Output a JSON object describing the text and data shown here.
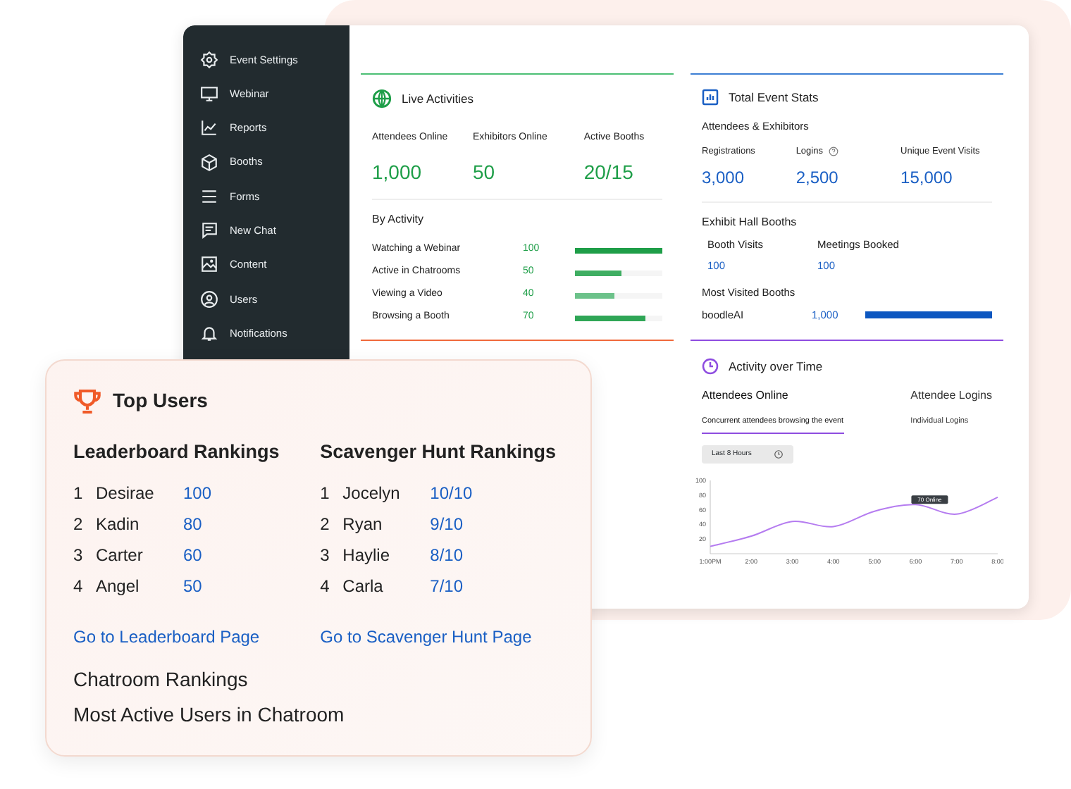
{
  "sidebar": {
    "items": [
      {
        "label": "Event Settings"
      },
      {
        "label": "Webinar"
      },
      {
        "label": "Reports"
      },
      {
        "label": "Booths"
      },
      {
        "label": "Forms"
      },
      {
        "label": "New Chat"
      },
      {
        "label": "Content"
      },
      {
        "label": "Users"
      },
      {
        "label": "Notifications"
      }
    ]
  },
  "live_activities": {
    "title": "Live Activities",
    "stats": [
      {
        "label": "Attendees Online",
        "value": "1,000"
      },
      {
        "label": "Exhibitors Online",
        "value": "50"
      },
      {
        "label": "Active Booths",
        "value": "20/15"
      }
    ],
    "by_activity": {
      "title": "By Activity",
      "rows": [
        {
          "label": "Watching a Webinar",
          "value": "100",
          "level": 1,
          "color": "#1e9e48"
        },
        {
          "label": "Active in Chatrooms",
          "value": "50",
          "level": 0.54,
          "color": "#3fae62"
        },
        {
          "label": "Viewing a Video",
          "value": "40",
          "level": 0.45,
          "color": "#6cc28a"
        },
        {
          "label": "Browsing a Booth",
          "value": "70",
          "level": 0.8,
          "color": "#2fa656"
        }
      ]
    }
  },
  "total_event_stats": {
    "title": "Total Event Stats",
    "subtitle": "Attendees & Exhibitors",
    "stats": [
      {
        "kind": "plain",
        "label": "Registrations",
        "value": "3,000"
      },
      {
        "kind": "help",
        "label": "Logins",
        "value": "2,500"
      },
      {
        "kind": "plain",
        "label": "Unique Event Visits",
        "value": "15,000"
      }
    ],
    "exhibit_hall": {
      "title": "Exhibit Hall Booths",
      "stats": [
        {
          "label": "Booth Visits",
          "value": "100"
        },
        {
          "label": "Meetings Booked",
          "value": "100"
        }
      ]
    },
    "most_visited": {
      "title": "Most Visited Booths",
      "rows": [
        {
          "label": "boodleAI",
          "value": "1,000",
          "level": 1
        }
      ]
    }
  },
  "activity_over_time": {
    "title": "Activity over Time",
    "tabs": [
      {
        "label": "Attendees Online",
        "description": "Concurrent attendees browsing the event",
        "selected": true
      },
      {
        "label": "Attendee Logins",
        "description": "Individual Logins",
        "selected": false
      }
    ],
    "range": "Last 8 Hours",
    "chart_data": {
      "type": "line",
      "categories": [
        "1:00PM",
        "2:00",
        "3:00",
        "4:00",
        "5:00",
        "6:00",
        "7:00",
        "8:00"
      ],
      "series": [
        {
          "color": "#b57cf0",
          "values": [
            10,
            24,
            44,
            37,
            58,
            67,
            54,
            77
          ]
        }
      ],
      "ylim": [
        0,
        100
      ],
      "yticks": [
        20,
        40,
        60,
        80,
        100
      ],
      "annotations": [
        {
          "x": "6:00",
          "y": 67,
          "text": "70 Online"
        }
      ]
    }
  },
  "top_users": {
    "title": "Top Users",
    "rankings": [
      {
        "title": "Leaderboard Rankings",
        "rows": [
          {
            "rank": "1",
            "name": "Desirae",
            "score": "100"
          },
          {
            "rank": "2",
            "name": "Kadin",
            "score": "80"
          },
          {
            "rank": "3",
            "name": "Carter",
            "score": "60"
          },
          {
            "rank": "4",
            "name": "Angel",
            "score": "50"
          }
        ],
        "link": "Go to Leaderboard Page"
      },
      {
        "title": "Scavenger Hunt Rankings",
        "rows": [
          {
            "rank": "1",
            "name": "Jocelyn",
            "score": "10/10"
          },
          {
            "rank": "2",
            "name": "Ryan",
            "score": "9/10"
          },
          {
            "rank": "3",
            "name": "Haylie",
            "score": "8/10"
          },
          {
            "rank": "4",
            "name": "Carla",
            "score": "7/10"
          }
        ],
        "link": "Go to Scavenger Hunt Page"
      }
    ],
    "chatroom_title": "Chatroom Rankings",
    "chatroom_subtitle": "Most Active Users in Chatroom"
  }
}
